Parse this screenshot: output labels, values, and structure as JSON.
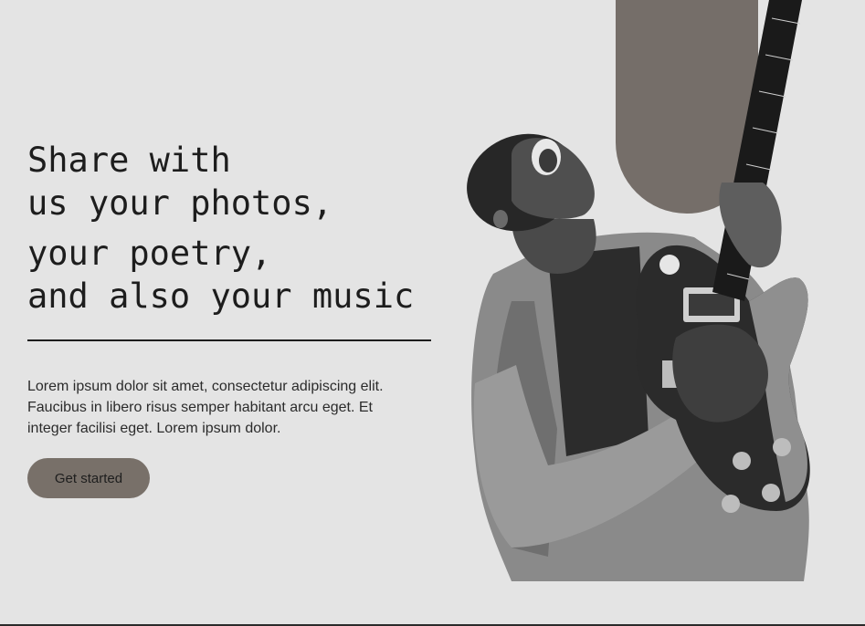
{
  "hero": {
    "headline": [
      "Share with",
      "us your photos,",
      "your poetry,",
      "and also your music"
    ],
    "body": "Lorem ipsum dolor sit amet, consectetur adipiscing elit. Faucibus in libero risus semper habitant arcu eget. Et integer facilisi eget. Lorem ipsum dolor.",
    "cta_label": "Get started"
  },
  "image": {
    "subject": "guitarist-photo"
  },
  "colors": {
    "background": "#e4e4e4",
    "accent": "#787069",
    "text": "#1d1d1d"
  }
}
